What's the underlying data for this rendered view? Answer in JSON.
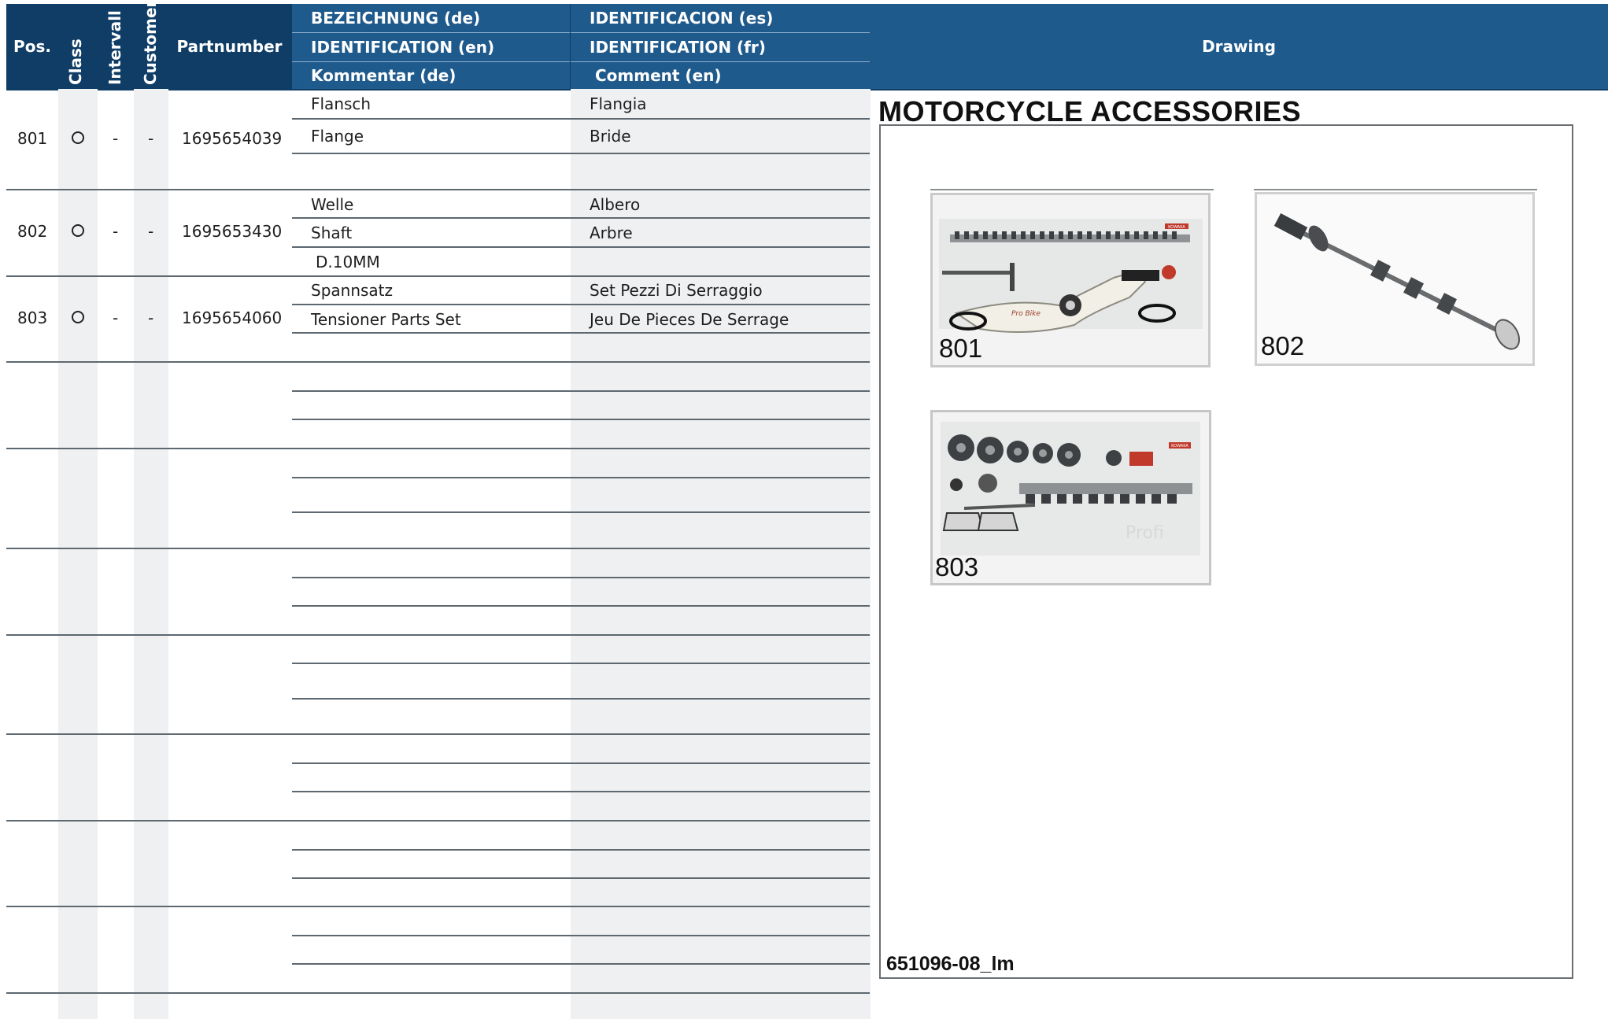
{
  "header": {
    "pos": "Pos.",
    "class": "Class",
    "intervall": "Intervall",
    "customer": "Customer",
    "partnumber": "Partnumber",
    "bez_de": "BEZEICHNUNG (de)",
    "ident_en": "IDENTIFICATION (en)",
    "komm_de": "Kommentar (de)",
    "ident_es": "IDENTIFICACION (es)",
    "ident_fr": "IDENTIFICATION (fr)",
    "comm_en": "Comment (en)",
    "drawing": "Drawing"
  },
  "rows": [
    {
      "pos": "801",
      "interval": "-",
      "customer": "-",
      "partnumber": "1695654039",
      "name_de": "Flansch",
      "name_en": "Flange",
      "comment_de": "",
      "name_es": "Flangia",
      "name_fr": "Bride",
      "comment_en": ""
    },
    {
      "pos": "802",
      "interval": "-",
      "customer": "-",
      "partnumber": "1695653430",
      "name_de": "Welle",
      "name_en": "Shaft",
      "comment_de": "D.10MM",
      "name_es": "Albero",
      "name_fr": "Arbre",
      "comment_en": ""
    },
    {
      "pos": "803",
      "interval": "-",
      "customer": "-",
      "partnumber": "1695654060",
      "name_de": "Spannsatz",
      "name_en": "Tensioner Parts Set",
      "comment_de": "",
      "name_es": "Set Pezzi Di Serraggio",
      "name_fr": "Jeu De Pieces De Serrage",
      "comment_en": ""
    }
  ],
  "drawing": {
    "title": "MOTORCYCLE ACCESSORIES",
    "labels": [
      "801",
      "802",
      "803"
    ],
    "code": "651096-08_lm",
    "photo_logo_text": "KOWAKA",
    "photo_bike_text": "Pro Bike",
    "photo_profi_text": "Profi"
  },
  "colors": {
    "header_dark": "#0f3d66",
    "header": "#1f5a8c",
    "shade": "#eef0f1",
    "line": "#5d6870"
  }
}
